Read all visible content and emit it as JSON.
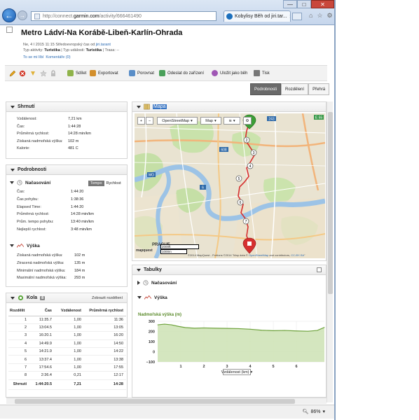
{
  "browser": {
    "url_prefix": "http://connect.",
    "url_domain": "garmin.com",
    "url_suffix": "/activity/666461490",
    "tab_title": "Kobylisy Běh od jiri.tar...",
    "close_glyph": "✕",
    "minimize_glyph": "—",
    "maximize_glyph": "□",
    "window_close_glyph": "✕",
    "home_glyph": "⌂",
    "star_glyph": "☆",
    "settings_glyph": "⚙",
    "zoom_value": "86%"
  },
  "activity": {
    "title": "Metro Ládví-Na Korábě-Libeň-Karlín-Ohrada",
    "meta_date": "Ne, 4 I 2015 11:15 Středoevropský čas od ",
    "meta_user": "jiri.tarant",
    "meta_type_label": "Typ aktivity: ",
    "meta_type_value": "Turistika",
    "meta_event_label": " | Typ události: ",
    "meta_event_value": "Turistika",
    "meta_route_label": " | Trasa: ",
    "meta_route_value": "--",
    "likes": "To se mi líbí",
    "comments": "Komentáře (0)"
  },
  "toolbar": {
    "share": "Sdílet",
    "export": "Exportovat",
    "compare": "Porovnat",
    "send": "Odeslat do zařízení",
    "save_course": "Uložit jako běh",
    "print": "Tisk"
  },
  "view_tabs": [
    "Podrobnosti",
    "Rozdělení",
    "Přehrá"
  ],
  "summary": {
    "title": "Shrnutí",
    "rows": [
      {
        "k": "Vzdálenost:",
        "v": "7,21 km"
      },
      {
        "k": "Čas:",
        "v": "1:44:28"
      },
      {
        "k": "Průměrná rychlost:",
        "v": "14:28 min/km"
      },
      {
        "k": "Získaná nadmořská výška:",
        "v": "102 m"
      },
      {
        "k": "Kalorie:",
        "v": "481 C"
      }
    ]
  },
  "details": {
    "title": "Podrobnosti",
    "timing_title": "Načasování",
    "toggle_pace": "Tempo",
    "toggle_speed": "Rychlost",
    "timing": [
      {
        "k": "Čas:",
        "v": "1:44:20"
      },
      {
        "k": "Čas pohybu:",
        "v": "1:38:36"
      },
      {
        "k": "Elapsed Time:",
        "v": "1:44:20"
      },
      {
        "k": "Průměrná rychlost:",
        "v": "14:28 min/km"
      },
      {
        "k": "Prům. tempo pohybu:",
        "v": "13:40 min/km"
      },
      {
        "k": "Nejlepší rychlost:",
        "v": "3:48 min/km"
      }
    ],
    "elevation_title": "Výška",
    "elevation": [
      {
        "k": "Získaná nadmořská výška:",
        "v": "102 m"
      },
      {
        "k": "Ztracená nadmořská výška:",
        "v": "135 m"
      },
      {
        "k": "Minimální nadmořská výška:",
        "v": "184 m"
      },
      {
        "k": "Maximální nadmořská výška:",
        "v": "293 m"
      }
    ]
  },
  "laps": {
    "title": "Kola",
    "count": "8",
    "show_splits": "Zobrazit rozdělení",
    "headers": [
      "Rozdělit",
      "Čas",
      "Vzdálenost",
      "Průměrná rychlost"
    ],
    "rows": [
      [
        "1",
        "11:35.7",
        "1,00",
        "11:36"
      ],
      [
        "2",
        "13:04.5",
        "1,00",
        "13:05"
      ],
      [
        "3",
        "16:20.1",
        "1,00",
        "16:20"
      ],
      [
        "4",
        "14:49.9",
        "1,00",
        "14:50"
      ],
      [
        "5",
        "14:21.9",
        "1,00",
        "14:22"
      ],
      [
        "6",
        "13:37.4",
        "1,00",
        "13:38"
      ],
      [
        "7",
        "17:54.6",
        "1,00",
        "17:55"
      ],
      [
        "8",
        "2:36.4",
        "0,21",
        "12:17"
      ]
    ],
    "total": [
      "Shrnutí",
      "1:44:20.5",
      "7,21",
      "14:28"
    ]
  },
  "map": {
    "title": "Mapa",
    "zoom_in": "+",
    "zoom_out": "−",
    "layer": "OpenStreetMap",
    "mode": "Map",
    "city": "PRAGUE",
    "provider": "mapquest",
    "scale_1": "2000ft",
    "scale_2": "1000m",
    "copyright_a": "©2014 MapQuest - Portions ©2014 ",
    "copyright_b": "\"Map data © ",
    "copyright_c": "OpenStreetMap",
    "copyright_d": " and contributors, ",
    "copyright_e": "CC-BY-SA",
    "copyright_f": "\"",
    "road_label_243": "243",
    "road_label_608": "608",
    "road_label_e55": "E 55",
    "road_label_mo": "MO",
    "road_label_6": "6"
  },
  "tables": {
    "title": "Tabulky",
    "timing": "Načasování",
    "elevation": "Výška"
  },
  "elevation_chart": {
    "title": "Nadmořská výška (m)",
    "xlabel": "Vzdálenost (km)",
    "y_ticks": [
      "300",
      "200",
      "100",
      "0",
      "−100"
    ],
    "x_ticks": [
      "1",
      "2",
      "3",
      "4",
      "5",
      "6"
    ]
  },
  "chart_data": {
    "type": "area",
    "title": "Nadmořská výška (m)",
    "xlabel": "Vzdálenost (km)",
    "ylabel": "",
    "ylim": [
      -100,
      300
    ],
    "xlim": [
      0,
      7.21
    ],
    "x": [
      0,
      0.3,
      0.6,
      0.9,
      1.2,
      1.6,
      2.0,
      2.5,
      3.0,
      3.5,
      4.0,
      4.5,
      5.0,
      5.5,
      6.0,
      6.5,
      6.9,
      7.21
    ],
    "values": [
      265,
      272,
      265,
      250,
      238,
      232,
      235,
      232,
      230,
      228,
      222,
      212,
      208,
      210,
      205,
      202,
      210,
      240
    ],
    "grid": true,
    "color": "#6ea23c"
  }
}
